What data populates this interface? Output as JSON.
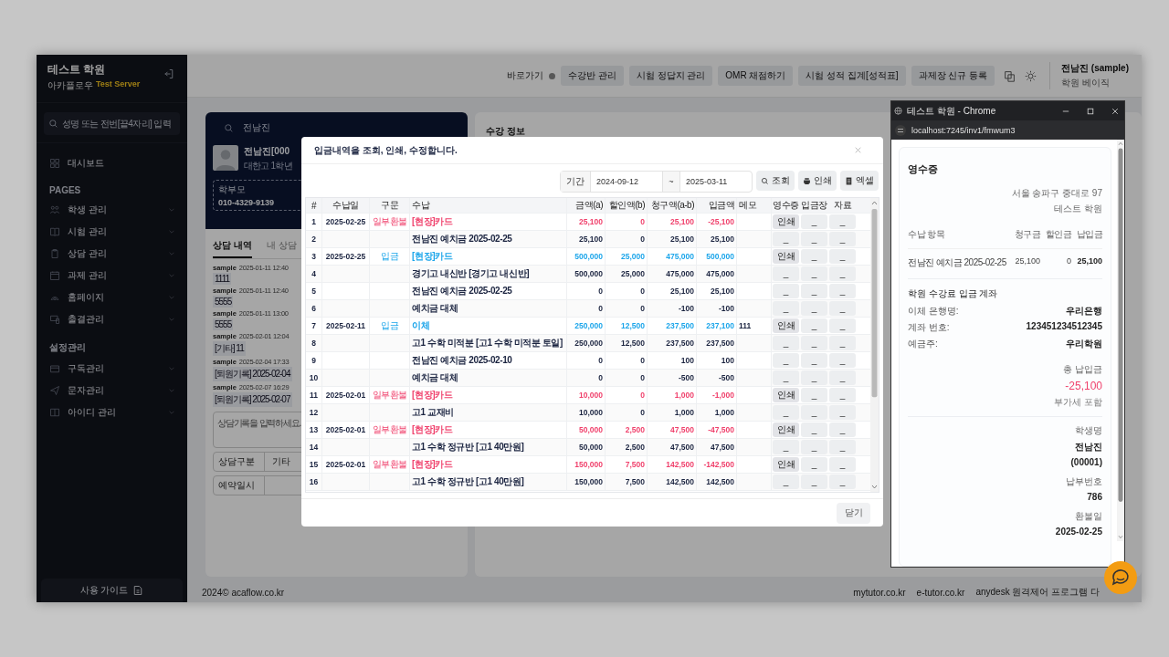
{
  "sidebar": {
    "brand": "테스트 학원",
    "subtitle": "아카플로우",
    "server": "Test Server",
    "search": {
      "placeholder": "성명 또는 전번[끝4자리] 입력"
    },
    "sections": [
      {
        "items": [
          {
            "label": "대시보드",
            "has_submenu": false
          }
        ]
      },
      {
        "title": "PAGES",
        "items": [
          {
            "label": "학생 관리",
            "has_submenu": true
          },
          {
            "label": "시험 관리",
            "has_submenu": true
          },
          {
            "label": "상담 관리",
            "has_submenu": true
          },
          {
            "label": "과제 관리",
            "has_submenu": true
          },
          {
            "label": "홈페이지",
            "has_submenu": true
          },
          {
            "label": "출결관리",
            "has_submenu": true
          }
        ]
      },
      {
        "title": "설정관리",
        "items": [
          {
            "label": "구독관리",
            "has_submenu": true
          },
          {
            "label": "문자관리",
            "has_submenu": true
          },
          {
            "label": "아이디 관리",
            "has_submenu": true
          }
        ]
      }
    ],
    "guide_button": "사용 가이드"
  },
  "topbar": {
    "shortcut_label": "바로가기",
    "shortcuts": [
      "수강반 관리",
      "시험 정답지 관리",
      "OMR 채점하기",
      "시험 성적 집계[성적표]",
      "과제장 신규 등록"
    ],
    "user_name": "전남진 (sample)",
    "user_plan": "학원 베이직"
  },
  "student_card": {
    "search_value": "전남진",
    "name": "전남진[000",
    "school": "대한고 1학년",
    "parent_label": "학부모",
    "parent_phone": "010-4329-9139"
  },
  "consult": {
    "tabs": [
      {
        "label": "상담 내역",
        "selected": true
      },
      {
        "label": "내 상담",
        "selected": false
      }
    ],
    "entries": [
      {
        "author": "sample",
        "time": "2025-01-11 12:40",
        "content": "1111"
      },
      {
        "author": "sample",
        "time": "2025-01-11 12:40",
        "content": "5555"
      },
      {
        "author": "sample",
        "time": "2025-01-11 13:00",
        "content": "5555"
      },
      {
        "author": "sample",
        "time": "2025-02-01 12:04",
        "content": "[기타] 11"
      },
      {
        "author": "sample",
        "time": "2025-02-04 17:33",
        "content": "[퇴원기록] 2025-02-04"
      },
      {
        "author": "sample",
        "time": "2025-02-07 16:29",
        "content": "[퇴원기록] 2025-02-07"
      }
    ],
    "note_placeholder": "상담기록을 입력하세요.",
    "type_label": "상담구분",
    "type_value": "기타",
    "date_label": "예약일시"
  },
  "right_panel": {
    "title": "수강 정보"
  },
  "footer": {
    "copyright": "2024©  acaflow.co.kr",
    "links": [
      "mytutor.co.kr",
      "e-tutor.co.kr",
      "anydesk 원격제어 프로그램 다"
    ]
  },
  "modal": {
    "title": "입금내역을 조회, 인쇄, 수정합니다.",
    "period_label": "기간",
    "date_from": "2024-09-12",
    "separator": "~",
    "date_to": "2025-03-11",
    "buttons": [
      "조회",
      "인쇄",
      "엑셀"
    ],
    "columns": [
      "#",
      "수납일",
      "구문",
      "수납",
      "금액(a)",
      "할인액(b)",
      "청구액(a-b)",
      "입금액",
      "메모",
      "영수증",
      "입금장",
      "자료"
    ],
    "rows": [
      {
        "num": "1",
        "date": "2025-02-25",
        "category": "일부환불",
        "item": "[현장]카드",
        "amount": "25,100",
        "discount": "0",
        "billed": "25,100",
        "paid": "-25,100",
        "kind": "refund",
        "receipt": "인쇄",
        "slip": "_",
        "file": "_"
      },
      {
        "num": "2",
        "item": "전남진 예치금 2025-02-25",
        "amount": "25,100",
        "discount": "0",
        "billed": "25,100",
        "paid": "25,100",
        "kind": "detail",
        "receipt": "_",
        "slip": "_",
        "file": "_"
      },
      {
        "num": "3",
        "date": "2025-02-25",
        "category": "입금",
        "item": "[현장]카드",
        "amount": "500,000",
        "discount": "25,000",
        "billed": "475,000",
        "paid": "500,000",
        "kind": "deposit",
        "receipt": "인쇄",
        "slip": "_",
        "file": "_"
      },
      {
        "num": "4",
        "item": "경기고 내신반 [경기고 내신반]",
        "amount": "500,000",
        "discount": "25,000",
        "billed": "475,000",
        "paid": "475,000",
        "kind": "detail",
        "receipt": "_",
        "slip": "_",
        "file": "_"
      },
      {
        "num": "5",
        "item": "전남진 예치금 2025-02-25",
        "amount": "0",
        "discount": "0",
        "billed": "25,100",
        "paid": "25,100",
        "kind": "detail",
        "receipt": "_",
        "slip": "_",
        "file": "_"
      },
      {
        "num": "6",
        "item": "예치금 대체",
        "amount": "0",
        "discount": "0",
        "billed": "-100",
        "paid": "-100",
        "kind": "detail",
        "receipt": "_",
        "slip": "_",
        "file": "_"
      },
      {
        "num": "7",
        "date": "2025-02-11",
        "category": "입금",
        "item": "이체",
        "amount": "250,000",
        "discount": "12,500",
        "billed": "237,500",
        "paid": "237,100",
        "memo": "111",
        "kind": "deposit",
        "receipt": "인쇄",
        "slip": "_",
        "file": "_"
      },
      {
        "num": "8",
        "item": "고1 수학 미적분 [고1 수학 미적분 토일]",
        "amount": "250,000",
        "discount": "12,500",
        "billed": "237,500",
        "paid": "237,500",
        "kind": "detail",
        "receipt": "_",
        "slip": "_",
        "file": "_"
      },
      {
        "num": "9",
        "item": "전남진 예치금 2025-02-10",
        "amount": "0",
        "discount": "0",
        "billed": "100",
        "paid": "100",
        "kind": "detail",
        "receipt": "_",
        "slip": "_",
        "file": "_"
      },
      {
        "num": "10",
        "item": "예치금 대체",
        "amount": "0",
        "discount": "0",
        "billed": "-500",
        "paid": "-500",
        "kind": "detail",
        "receipt": "_",
        "slip": "_",
        "file": "_"
      },
      {
        "num": "11",
        "date": "2025-02-01",
        "category": "일부환불",
        "item": "[현장]카드",
        "amount": "10,000",
        "discount": "0",
        "billed": "1,000",
        "paid": "-1,000",
        "kind": "refund",
        "receipt": "인쇄",
        "slip": "_",
        "file": "_"
      },
      {
        "num": "12",
        "item": "고1 교재비",
        "amount": "10,000",
        "discount": "0",
        "billed": "1,000",
        "paid": "1,000",
        "kind": "detail",
        "receipt": "_",
        "slip": "_",
        "file": "_"
      },
      {
        "num": "13",
        "date": "2025-02-01",
        "category": "일부환불",
        "item": "[현장]카드",
        "amount": "50,000",
        "discount": "2,500",
        "billed": "47,500",
        "paid": "-47,500",
        "kind": "refund",
        "receipt": "인쇄",
        "slip": "_",
        "file": "_"
      },
      {
        "num": "14",
        "item": "고1 수학 정규반 [고1 40만원]",
        "amount": "50,000",
        "discount": "2,500",
        "billed": "47,500",
        "paid": "47,500",
        "kind": "detail",
        "receipt": "_",
        "slip": "_",
        "file": "_"
      },
      {
        "num": "15",
        "date": "2025-02-01",
        "category": "일부환불",
        "item": "[현장]카드",
        "amount": "150,000",
        "discount": "7,500",
        "billed": "142,500",
        "paid": "-142,500",
        "kind": "refund",
        "receipt": "인쇄",
        "slip": "_",
        "file": "_"
      },
      {
        "num": "16",
        "item": "고1 수학 정규반 [고1 40만원]",
        "amount": "150,000",
        "discount": "7,500",
        "billed": "142,500",
        "paid": "142,500",
        "kind": "detail",
        "receipt": "_",
        "slip": "_",
        "file": "_"
      }
    ],
    "close_button": "닫기"
  },
  "popup": {
    "window_title": "테스트 학원 - Chrome",
    "url": "localhost:7245/inv1/fmwum3",
    "receipt": {
      "title": "영수증",
      "address": "서울 송파구 중대로 97",
      "academy": "테스트 학원",
      "columns": [
        "수납 항목",
        "청구금",
        "할인금",
        "납입금"
      ],
      "items": [
        {
          "name": "전남진 예치금 2025-02-25",
          "billed": "25,100",
          "discount": "0",
          "paid": "25,100"
        }
      ],
      "account_title": "학원 수강료 입금 계좌",
      "account": [
        {
          "label": "이체 은행명:",
          "value": "우리은행"
        },
        {
          "label": "계좌 번호:",
          "value": "123451234512345"
        },
        {
          "label": "예금주:",
          "value": "우리학원"
        }
      ],
      "total_label": "총 납입금",
      "total": "-25,100",
      "vat_note": "부가세 포함",
      "student_label": "학생명",
      "student_name": "전남진",
      "student_id": "(00001)",
      "payment_no_label": "납부번호",
      "payment_no": "786",
      "refund_date_label": "환불일",
      "refund_date": "2025-02-25"
    }
  }
}
